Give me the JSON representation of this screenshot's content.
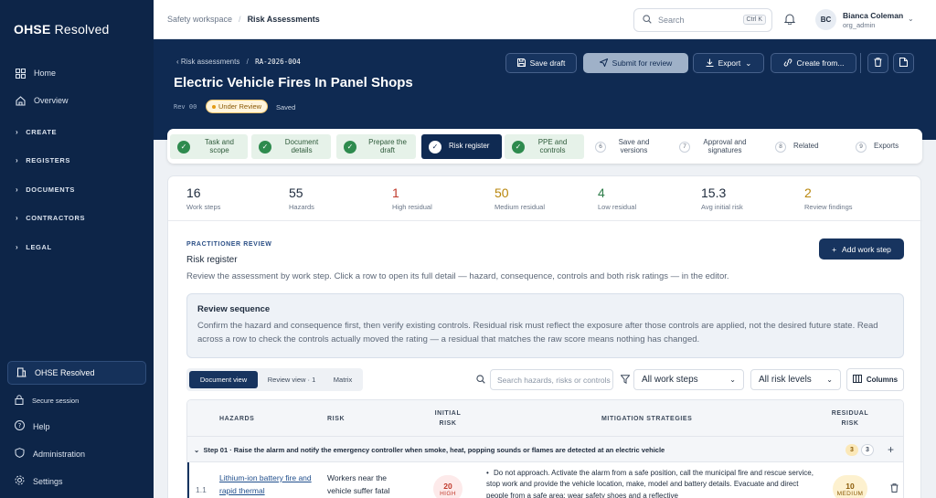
{
  "app": {
    "brand_bold": "OHSE",
    "brand_light": " Resolved"
  },
  "sidebar": {
    "items": [
      {
        "label": "Home",
        "icon": "grid-icon"
      },
      {
        "label": "Overview",
        "icon": "home-icon"
      }
    ],
    "sections": [
      "CREATE",
      "REGISTERS",
      "DOCUMENTS",
      "CONTRACTORS",
      "LEGAL"
    ],
    "org": "OHSE Resolved",
    "bottom": [
      {
        "label": "Secure session",
        "icon": "lock-icon"
      },
      {
        "label": "Help",
        "icon": "help-icon"
      },
      {
        "label": "Administration",
        "icon": "shield-icon"
      },
      {
        "label": "Settings",
        "icon": "gear-icon"
      }
    ]
  },
  "topbar": {
    "crumb_root": "Safety workspace",
    "crumb_current": "Risk Assessments",
    "search_placeholder": "Search",
    "shortcut": "Ctrl K",
    "user_initials": "BC",
    "user_name": "Bianca Coleman",
    "user_role": "org_admin"
  },
  "doc": {
    "back_label": "Risk assessments",
    "id": "RA-2026-004",
    "title": "Electric Vehicle Fires In Panel Shops",
    "rev": "Rev 00",
    "status": "Under Review",
    "saved": "Saved",
    "actions": {
      "save_draft": "Save draft",
      "submit": "Submit for review",
      "export": "Export",
      "create_from": "Create from..."
    }
  },
  "steps": [
    {
      "label": "Task and scope",
      "state": "done"
    },
    {
      "label": "Document details",
      "state": "done"
    },
    {
      "label": "Prepare the draft",
      "state": "done"
    },
    {
      "label": "Risk register",
      "state": "active"
    },
    {
      "label": "PPE and controls",
      "state": "done"
    },
    {
      "label": "Save and versions",
      "num": "6",
      "state": "todo"
    },
    {
      "label": "Approval and signatures",
      "num": "7",
      "state": "todo"
    },
    {
      "label": "Related",
      "num": "8",
      "state": "todo"
    },
    {
      "label": "Exports",
      "num": "9",
      "state": "todo"
    }
  ],
  "stats": [
    {
      "value": "16",
      "label": "Work steps",
      "color": "#1e2b3d"
    },
    {
      "value": "55",
      "label": "Hazards",
      "color": "#1e2b3d"
    },
    {
      "value": "1",
      "label": "High residual",
      "color": "#c0392b"
    },
    {
      "value": "50",
      "label": "Medium residual",
      "color": "#b8860b"
    },
    {
      "value": "4",
      "label": "Low residual",
      "color": "#2e7d4a"
    },
    {
      "value": "15.3",
      "label": "Avg initial risk",
      "color": "#1e2b3d"
    },
    {
      "value": "2",
      "label": "Review findings",
      "color": "#b8860b"
    }
  ],
  "register": {
    "eyebrow": "PRACTITIONER REVIEW",
    "title": "Risk register",
    "description": "Review the assessment by work step. Click a row to open its full detail — hazard, consequence, controls and both risk ratings — in the editor.",
    "add_button": "Add work step",
    "callout_title": "Review sequence",
    "callout_body": "Confirm the hazard and consequence first, then verify existing controls. Residual risk must reflect the exposure after those controls are applied, not the desired future state. Read across a row to check the controls actually moved the rating — a residual that matches the raw score means nothing has changed."
  },
  "toolbar": {
    "views": [
      "Document view",
      "Review view · 1",
      "Matrix"
    ],
    "search_placeholder": "Search hazards, risks or controls",
    "work_steps": "All work steps",
    "risk_levels": "All risk levels",
    "columns": "Columns"
  },
  "table": {
    "headers": {
      "hazards": "HAZARDS",
      "risk": "RISK",
      "initial_1": "INITIAL",
      "initial_2": "RISK",
      "mitigation": "MITIGATION STRATEGIES",
      "residual_1": "RESIDUAL",
      "residual_2": "RISK"
    },
    "group": {
      "title": "Step 01 · Raise the alarm and notify the emergency controller when smoke, heat, popping sounds or flames are detected at an electric vehicle",
      "badge_a": "3",
      "badge_b": "3"
    },
    "row": {
      "num": "1.1",
      "hazard": "Lithium-ion battery fire and rapid thermal",
      "risk": "Workers near the vehicle suffer fatal",
      "initial_value": "20",
      "initial_level": "HIGH",
      "mitigation": "Do not approach. Activate the alarm from a safe position, call the municipal fire and rescue service, stop work and provide the vehicle location, make, model and battery details. Evacuate and direct people from a safe area; wear safety shoes and a reflective",
      "residual_value": "10",
      "residual_level": "MEDIUM"
    }
  }
}
